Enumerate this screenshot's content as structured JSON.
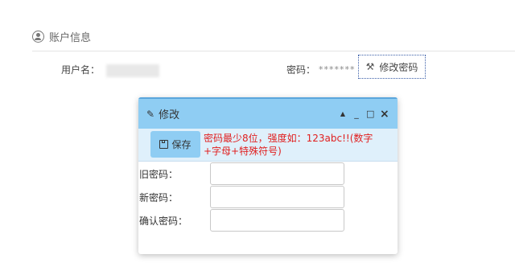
{
  "section": {
    "title": "账户信息",
    "icon": "user-icon"
  },
  "account": {
    "username_label": "用户名：",
    "password_label": "密码：",
    "password_mask": "*******",
    "change_password_button": "修改密码",
    "change_password_icon": "key-icon"
  },
  "dialog": {
    "title": "修改",
    "title_icon": "pencil-icon",
    "controls": {
      "collapse": "▲",
      "minimize": "_",
      "maximize": "□",
      "close": "×"
    },
    "save_label": "保存",
    "save_icon": "floppy-icon",
    "hint": "密码最少8位，强度如：123abc!!(数字+字母+特殊符号)",
    "fields": [
      {
        "label": "旧密码：",
        "value": ""
      },
      {
        "label": "新密码：",
        "value": ""
      },
      {
        "label": "确认密码：",
        "value": ""
      }
    ]
  },
  "colors": {
    "titlebar": "#8fcdf3",
    "toolbar": "#dff0fb",
    "hint_text": "#e02020",
    "focus_border": "#3a5ea8"
  }
}
